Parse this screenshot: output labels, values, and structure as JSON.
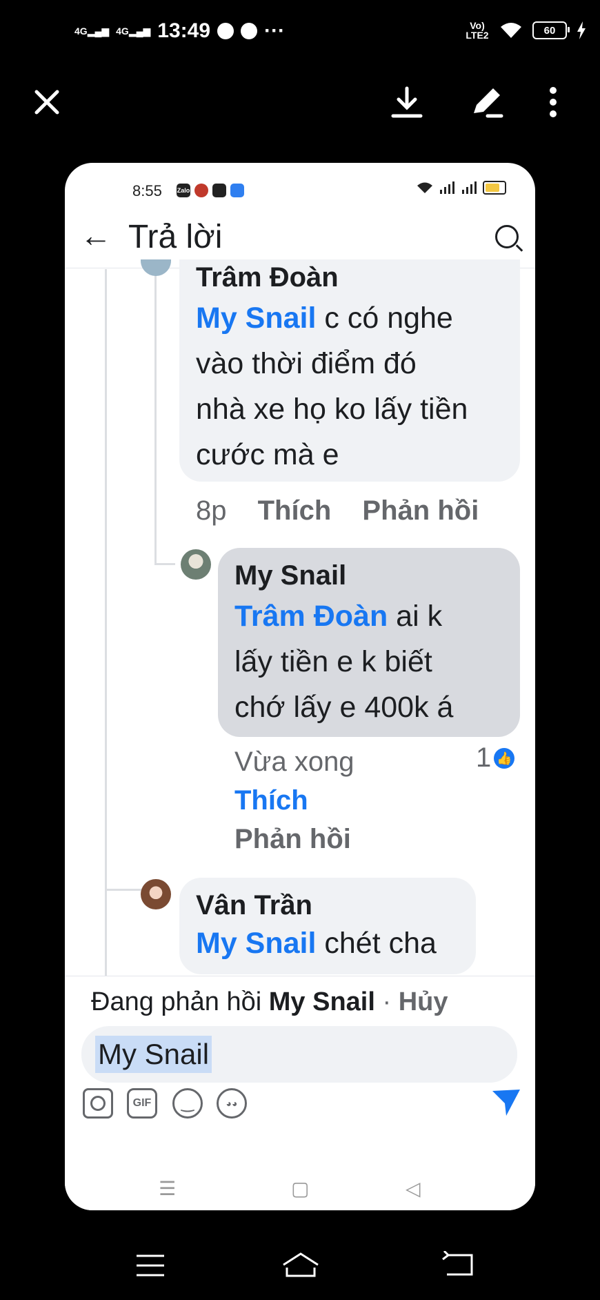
{
  "status_bar": {
    "signal_1": "4G",
    "signal_2": "4G",
    "time": "13:49",
    "more": "···",
    "volte": "Vo) LTE2",
    "battery": "60"
  },
  "viewer": {
    "close_icon": "close-icon",
    "download_icon": "download-icon",
    "edit_icon": "edit-icon",
    "more_icon": "more-vert-icon"
  },
  "screenshot": {
    "status": {
      "time": "8:55",
      "app_icon_1": "Zalo"
    },
    "header": {
      "title": "Trả lời"
    },
    "comments": [
      {
        "name": "Trâm Đoàn",
        "mention": "My Snail",
        "text_line1": " c có nghe",
        "text_line2": "vào thời điểm đó",
        "text_line3": "nhà xe họ ko lấy tiền",
        "text_line4": "cước mà e",
        "time": "8p",
        "like": "Thích",
        "reply": "Phản hồi"
      },
      {
        "name": "My Snail",
        "mention": "Trâm Đoàn",
        "text_line1": " ai k",
        "text_line2": "lấy tiền e k biết",
        "text_line3": "chớ lấy e 400k á",
        "time": "Vừa xong",
        "like": "Thích",
        "reply": "Phản hồi",
        "reactions": "1"
      },
      {
        "name": "Vân Trần",
        "mention": "My Snail",
        "text": " chét cha"
      }
    ],
    "reply_bar": {
      "replying_prefix": "Đang phản hồi ",
      "replying_to": "My Snail",
      "separator": " · ",
      "cancel": "Hủy",
      "input_value": "My Snail",
      "gif_label": "GIF"
    }
  }
}
